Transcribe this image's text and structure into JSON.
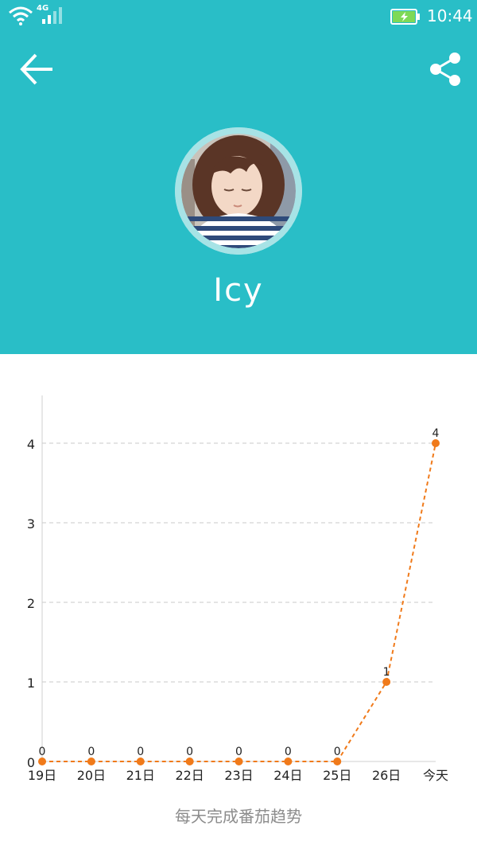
{
  "status_bar": {
    "network": "4G",
    "time": "10:44"
  },
  "profile": {
    "name": "Icy"
  },
  "colors": {
    "header_bg": "#29bec7",
    "line": "#f07a1a",
    "battery": "#7ed957"
  },
  "icons": {
    "back": "arrow-left-icon",
    "share": "share-icon"
  },
  "chart_data": {
    "type": "line",
    "categories": [
      "19日",
      "20日",
      "21日",
      "22日",
      "23日",
      "24日",
      "25日",
      "26日",
      "今天"
    ],
    "values": [
      0,
      0,
      0,
      0,
      0,
      0,
      0,
      1,
      4
    ],
    "ylim": [
      0,
      4.6
    ],
    "yticks": [
      0,
      1,
      2,
      3,
      4
    ],
    "grid": "horizontal-dashed",
    "line_style": "dashed",
    "data_labels": true,
    "caption": "每天完成番茄趋势"
  }
}
